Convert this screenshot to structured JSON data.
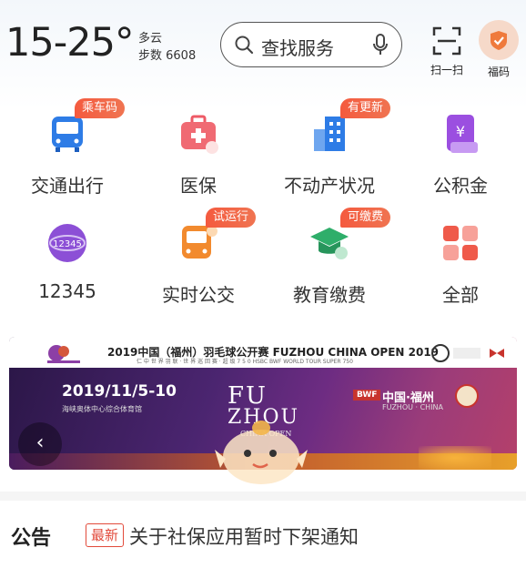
{
  "header": {
    "temperature": "15-25°",
    "weather": "多云",
    "steps": "步数 6608",
    "search_placeholder": "查找服务",
    "scan_label": "扫一扫",
    "fuma_label": "福码"
  },
  "services": [
    {
      "label": "交通出行",
      "icon": "bus-icon",
      "badge": "乘车码"
    },
    {
      "label": "医保",
      "icon": "medical-kit-icon",
      "badge": ""
    },
    {
      "label": "不动产状况",
      "icon": "building-icon",
      "badge": "有更新"
    },
    {
      "label": "公积金",
      "icon": "fund-card-icon",
      "badge": ""
    },
    {
      "label": "12345",
      "icon": "hotline-12345-icon",
      "badge": ""
    },
    {
      "label": "实时公交",
      "icon": "realtime-bus-icon",
      "badge": "试运行"
    },
    {
      "label": "教育缴费",
      "icon": "graduation-cap-icon",
      "badge": "可缴费"
    },
    {
      "label": "全部",
      "icon": "all-apps-icon",
      "badge": ""
    }
  ],
  "banner": {
    "title": "2019中国（福州）羽毛球公开赛 FUZHOU CHINA OPEN 2019",
    "subtitle": "仁 中 世 界 羽 联 · 世 界 巡 回 赛 · 超 级 7 5 0  HSBC BWF WORLD TOUR SUPER 750",
    "date": "2019/11/5-10",
    "venue": "海峡奥体中心综合体育馆",
    "fz_line1": "FU",
    "fz_line2": "ZHOU",
    "fz_line3": "CHINA OPEN",
    "city_cn": "中国·福州",
    "city_en": "FUZHOU · CHINA",
    "bwf": "BWF",
    "prev": "‹"
  },
  "notice": {
    "title": "公告",
    "tag": "最新",
    "text": "关于社保应用暂时下架通知"
  },
  "colors": {
    "accent": "#2b7de9",
    "badge": "#f45a3f",
    "banner_purple": "#4b2570"
  }
}
